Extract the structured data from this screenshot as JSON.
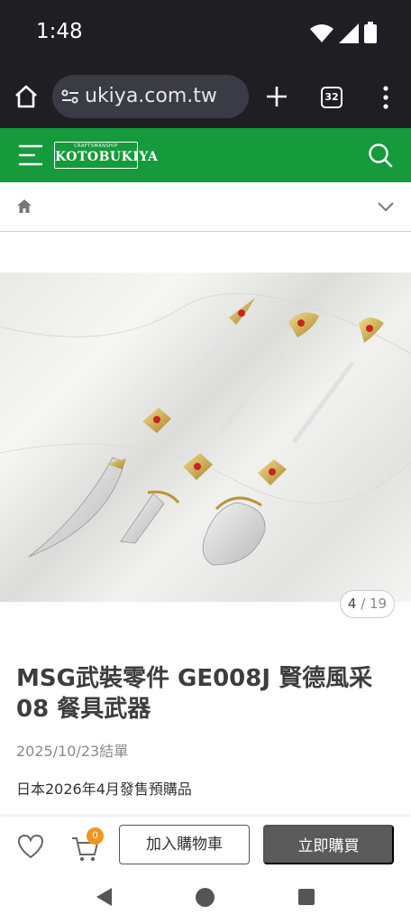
{
  "status_bar": {
    "time": "1:48"
  },
  "browser": {
    "url": "kotobukiya.com.tw",
    "url_visible": "ukiya.com.tw",
    "tab_count": "32"
  },
  "site": {
    "logo_small": "CRAFTSMANSHIP",
    "logo_main": "KOTOBUKIYA",
    "brand_color": "#159a3c"
  },
  "gallery": {
    "current": "4",
    "separator": " / ",
    "total": "19"
  },
  "product": {
    "title": "MSG武裝零件 GE008J 賢德風采08 餐具武器",
    "date": "2025/10/23結單",
    "subtitle": "日本2026年4月發售預購品"
  },
  "actions": {
    "cart_count": "0",
    "add_to_cart": "加入購物車",
    "buy_now": "立即購買"
  },
  "icons": [
    "home-icon",
    "site-info-icon",
    "plus-icon",
    "tabs-icon",
    "more-icon",
    "hamburger-icon",
    "search-icon",
    "breadcrumb-home-icon",
    "chevron-down-icon",
    "heart-icon",
    "cart-icon",
    "back-icon",
    "home-nav-icon",
    "recents-icon"
  ]
}
